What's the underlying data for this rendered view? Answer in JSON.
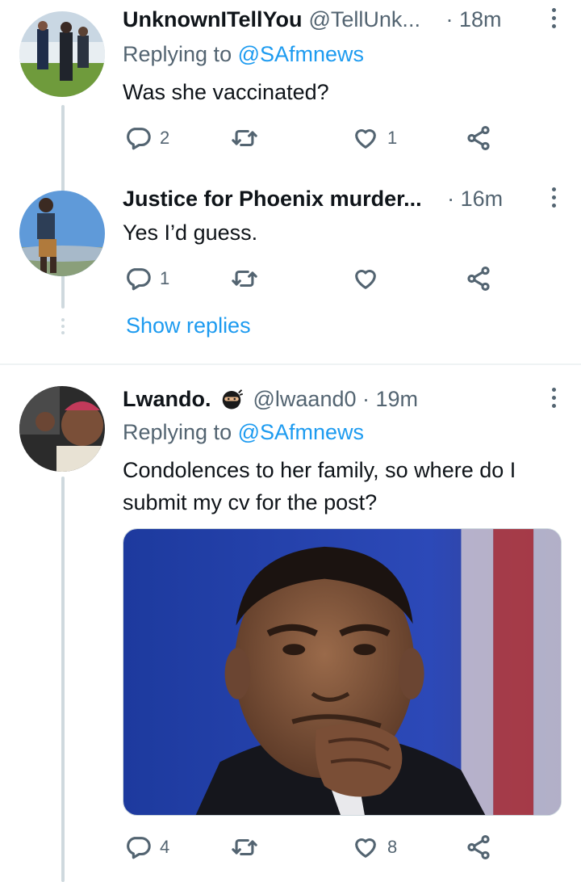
{
  "tweets": [
    {
      "name": "UnknownITellYou",
      "handle": "@TellUnk...",
      "sep": " · ",
      "time": "18m",
      "replying_prefix": "Replying to ",
      "replying_to": "@SAfmnews",
      "text": "Was she vaccinated?",
      "replies": "2",
      "retweets": "",
      "likes": "1"
    },
    {
      "name": "Justice for Phoenix murder...",
      "handle": "",
      "sep": " · ",
      "time": "16m",
      "text": "Yes I’d guess.",
      "replies": "1",
      "retweets": "",
      "likes": ""
    },
    {
      "name": "Lwando.",
      "handle": "@lwaand0",
      "sep": " · ",
      "time": "19m",
      "replying_prefix": "Replying to ",
      "replying_to": "@SAfmnews",
      "text": "Condolences to her family, so where do I submit my cv for the post?",
      "replies": "4",
      "retweets": "",
      "likes": "8"
    }
  ],
  "show_replies_label": "Show replies",
  "icons": {
    "reply": "reply-icon",
    "retweet": "retweet-icon",
    "like": "heart-icon",
    "share": "share-icon",
    "more": "more-vertical-icon",
    "badge": "ninja-emoji-icon"
  },
  "colors": {
    "link": "#1d9bf0",
    "secondary_text": "#536471",
    "thread_line": "#cfd9de"
  }
}
